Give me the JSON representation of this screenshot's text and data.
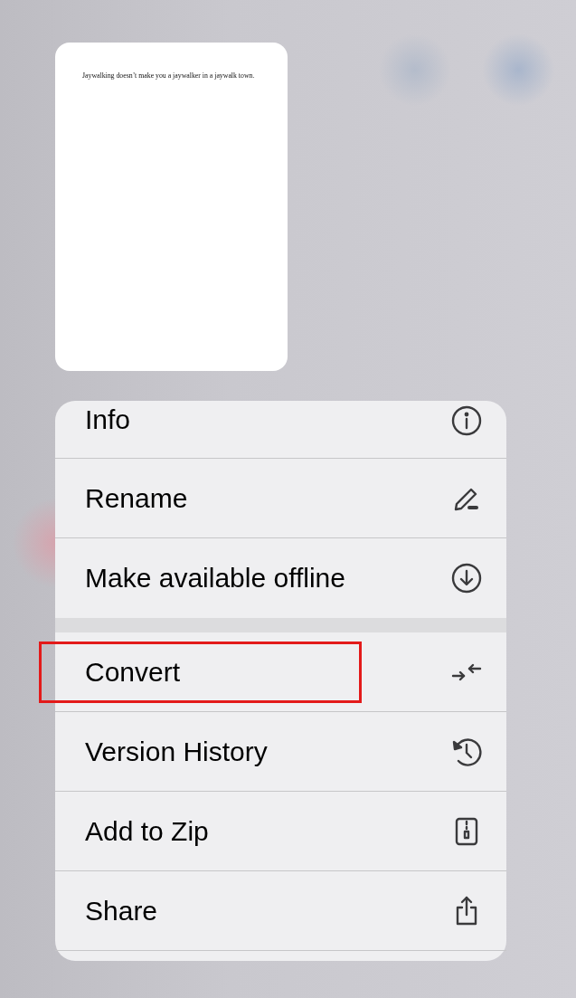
{
  "preview": {
    "text": "Jaywalking doesn’t make you a jaywalker in a jaywalk town."
  },
  "menu": {
    "groups": [
      {
        "items": [
          {
            "label": "Info",
            "kind": "info",
            "annotated": false
          },
          {
            "label": "Rename",
            "kind": "pencil",
            "annotated": false
          },
          {
            "label": "Make available offline",
            "kind": "download",
            "annotated": false
          }
        ]
      },
      {
        "items": [
          {
            "label": "Convert",
            "kind": "convert",
            "annotated": true
          },
          {
            "label": "Version History",
            "kind": "history",
            "annotated": false
          },
          {
            "label": "Add to Zip",
            "kind": "zip",
            "annotated": false
          },
          {
            "label": "Share",
            "kind": "share",
            "annotated": false
          }
        ]
      }
    ]
  }
}
